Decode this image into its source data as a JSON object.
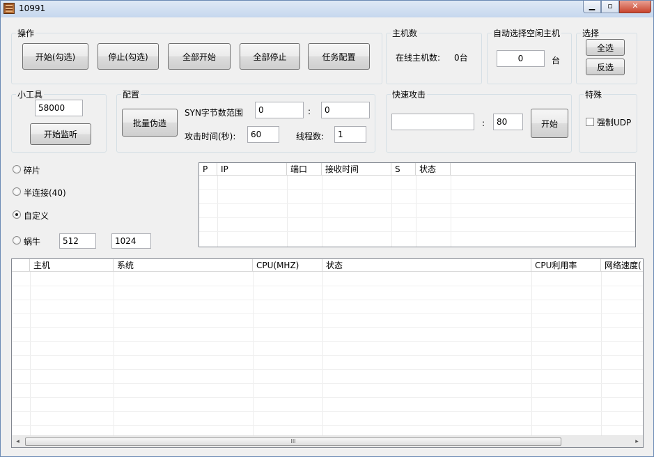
{
  "window": {
    "title": "10991"
  },
  "groups": {
    "ops": {
      "legend": "操作",
      "buttons": [
        "开始(勾选)",
        "停止(勾选)",
        "全部开始",
        "全部停止",
        "任务配置"
      ]
    },
    "hosts": {
      "legend": "主机数",
      "online_label": "在线主机数:",
      "online_value": "0台"
    },
    "auto": {
      "legend": "自动选择空闲主机",
      "value": "0",
      "unit": "台"
    },
    "select": {
      "legend": "选择",
      "all": "全选",
      "invert": "反选"
    },
    "tools": {
      "legend": "小工具",
      "port": "58000",
      "listen": "开始监听"
    },
    "config": {
      "legend": "配置",
      "batch": "批量伪造",
      "syn_label": "SYN字节数范围",
      "syn_from": "0",
      "syn_sep": ":",
      "syn_to": "0",
      "time_label": "攻击时间(秒):",
      "time_value": "60",
      "threads_label": "线程数:",
      "threads_value": "1"
    },
    "quick": {
      "legend": "快速攻击",
      "target": "",
      "sep": ":",
      "port": "80",
      "start": "开始"
    },
    "special": {
      "legend": "特殊",
      "force_udp": "强制UDP"
    }
  },
  "modes": {
    "fragment": "碎片",
    "half_connect": "半连接(40)",
    "custom": "自定义",
    "snail": "蜗牛",
    "snail_min": "512",
    "snail_max": "1024",
    "selected": "custom"
  },
  "packet_list": {
    "columns": [
      "P",
      "IP",
      "端口",
      "接收时间",
      "S",
      "状态"
    ]
  },
  "host_list": {
    "columns": [
      "",
      "主机",
      "系统",
      "CPU(MHZ)",
      "状态",
      "CPU利用率",
      "网络速度("
    ]
  },
  "scrollbar": {
    "left": "◂",
    "right": "▸",
    "grip": "III"
  }
}
